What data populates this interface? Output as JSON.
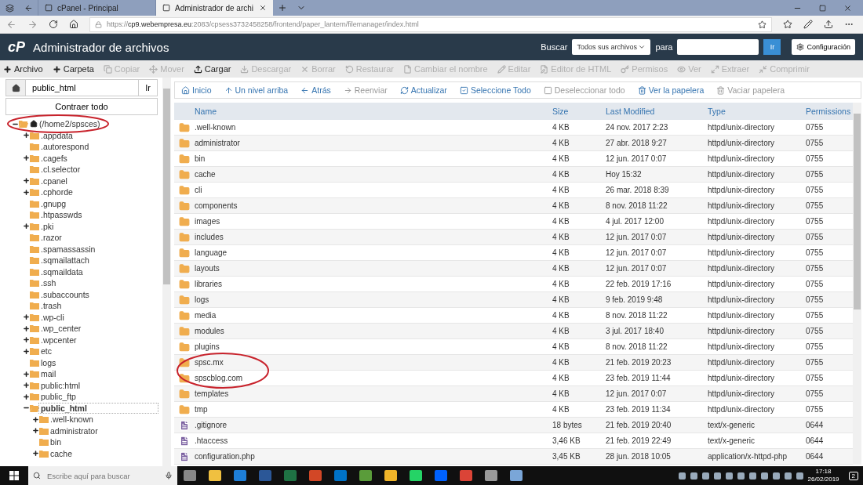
{
  "browser": {
    "tabs": [
      {
        "title": "cPanel - Principal",
        "selected": false
      },
      {
        "title": "Administrador de archi",
        "selected": true
      }
    ],
    "url": "https://**cp9.webempresa.eu**:2083/cpsess3732458258/frontend/paper_lantern/filemanager/index.html"
  },
  "header": {
    "logo": "cP",
    "title": "Administrador de archivos",
    "search_label": "Buscar",
    "scope": "Todos sus archivos",
    "for_label": "para",
    "go": "Ir",
    "settings": "Configuración"
  },
  "toolbar": [
    {
      "label": "Archivo",
      "disabled": false
    },
    {
      "label": "Carpeta",
      "disabled": false
    },
    {
      "label": "Copiar",
      "disabled": true
    },
    {
      "label": "Mover",
      "disabled": true
    },
    {
      "label": "Cargar",
      "disabled": false
    },
    {
      "label": "Descargar",
      "disabled": true
    },
    {
      "label": "Borrar",
      "disabled": true
    },
    {
      "label": "Restaurar",
      "disabled": true
    },
    {
      "label": "Cambiar el nombre",
      "disabled": true
    },
    {
      "label": "Editar",
      "disabled": true
    },
    {
      "label": "Editor de HTML",
      "disabled": true
    },
    {
      "label": "Permisos",
      "disabled": true
    },
    {
      "label": "Ver",
      "disabled": true
    },
    {
      "label": "Extraer",
      "disabled": true
    },
    {
      "label": "Comprimir",
      "disabled": true
    }
  ],
  "sidebar": {
    "path": "public_html",
    "go": "Ir",
    "collapse": "Contraer todo",
    "tree": [
      {
        "label": "(/home2/spsces)",
        "circled": true,
        "expandable": true,
        "expanded": true,
        "selected": false,
        "children": [
          {
            "label": ".appdata",
            "expandable": true,
            "expanded": false,
            "selected": false
          },
          {
            "label": ".autorespond",
            "expandable": false,
            "expanded": false,
            "selected": false
          },
          {
            "label": ".cagefs",
            "expandable": true,
            "expanded": false,
            "selected": false
          },
          {
            "label": ".cl.selector",
            "expandable": false,
            "expanded": false,
            "selected": false
          },
          {
            "label": ".cpanel",
            "expandable": true,
            "expanded": false,
            "selected": false
          },
          {
            "label": ".cphorde",
            "expandable": true,
            "expanded": false,
            "selected": false
          },
          {
            "label": ".gnupg",
            "expandable": false,
            "expanded": false,
            "selected": false
          },
          {
            "label": ".htpasswds",
            "expandable": false,
            "expanded": false,
            "selected": false
          },
          {
            "label": ".pki",
            "expandable": true,
            "expanded": false,
            "selected": false
          },
          {
            "label": ".razor",
            "expandable": false,
            "expanded": false,
            "selected": false
          },
          {
            "label": ".spamassassin",
            "expandable": false,
            "expanded": false,
            "selected": false
          },
          {
            "label": ".sqmailattach",
            "expandable": false,
            "expanded": false,
            "selected": false
          },
          {
            "label": ".sqmaildata",
            "expandable": false,
            "expanded": false,
            "selected": false
          },
          {
            "label": ".ssh",
            "expandable": false,
            "expanded": false,
            "selected": false
          },
          {
            "label": ".subaccounts",
            "expandable": false,
            "expanded": false,
            "selected": false
          },
          {
            "label": ".trash",
            "expandable": false,
            "expanded": false,
            "selected": false
          },
          {
            "label": ".wp-cli",
            "expandable": true,
            "expanded": false,
            "selected": false
          },
          {
            "label": ".wp_center",
            "expandable": true,
            "expanded": false,
            "selected": false
          },
          {
            "label": ".wpcenter",
            "expandable": true,
            "expanded": false,
            "selected": false
          },
          {
            "label": "etc",
            "expandable": true,
            "expanded": false,
            "selected": false
          },
          {
            "label": "logs",
            "expandable": false,
            "expanded": false,
            "selected": false
          },
          {
            "label": "mail",
            "expandable": true,
            "expanded": false,
            "selected": false
          },
          {
            "label": "public:html",
            "expandable": true,
            "expanded": false,
            "selected": false
          },
          {
            "label": "public_ftp",
            "expandable": true,
            "expanded": false,
            "selected": false
          },
          {
            "label": "public_html",
            "expandable": true,
            "expanded": true,
            "selected": true,
            "children": [
              {
                "label": ".well-known",
                "expandable": true,
                "expanded": false,
                "selected": false
              },
              {
                "label": "administrator",
                "expandable": true,
                "expanded": false,
                "selected": false
              },
              {
                "label": "bin",
                "expandable": false,
                "expanded": false,
                "selected": false
              },
              {
                "label": "cache",
                "expandable": true,
                "expanded": false,
                "selected": false
              }
            ]
          }
        ]
      }
    ]
  },
  "nav": [
    {
      "label": "Inicio",
      "disabled": false
    },
    {
      "label": "Un nivel arriba",
      "disabled": false
    },
    {
      "label": "Atrás",
      "disabled": false
    },
    {
      "label": "Reenviar",
      "disabled": true
    },
    {
      "label": "Actualizar",
      "disabled": false
    },
    {
      "label": "Seleccione Todo",
      "disabled": false
    },
    {
      "label": "Deseleccionar todo",
      "disabled": true
    },
    {
      "label": "Ver la papelera",
      "disabled": false
    },
    {
      "label": "Vaciar papelera",
      "disabled": true
    }
  ],
  "table": {
    "columns": [
      "Name",
      "Size",
      "Last Modified",
      "Type",
      "Permissions"
    ],
    "rows": [
      {
        "kind": "folder",
        "name": ".well-known",
        "size": "4 KB",
        "modified": "24 nov. 2017 2:23",
        "type": "httpd/unix-directory",
        "perms": "0755",
        "circled": false
      },
      {
        "kind": "folder",
        "name": "administrator",
        "size": "4 KB",
        "modified": "27 abr. 2018 9:27",
        "type": "httpd/unix-directory",
        "perms": "0755",
        "circled": false
      },
      {
        "kind": "folder",
        "name": "bin",
        "size": "4 KB",
        "modified": "12 jun. 2017 0:07",
        "type": "httpd/unix-directory",
        "perms": "0755",
        "circled": false
      },
      {
        "kind": "folder",
        "name": "cache",
        "size": "4 KB",
        "modified": "Hoy 15:32",
        "type": "httpd/unix-directory",
        "perms": "0755",
        "circled": false
      },
      {
        "kind": "folder",
        "name": "cli",
        "size": "4 KB",
        "modified": "26 mar. 2018 8:39",
        "type": "httpd/unix-directory",
        "perms": "0755",
        "circled": false
      },
      {
        "kind": "folder",
        "name": "components",
        "size": "4 KB",
        "modified": "8 nov. 2018 11:22",
        "type": "httpd/unix-directory",
        "perms": "0755",
        "circled": false
      },
      {
        "kind": "folder",
        "name": "images",
        "size": "4 KB",
        "modified": "4 jul. 2017 12:00",
        "type": "httpd/unix-directory",
        "perms": "0755",
        "circled": false
      },
      {
        "kind": "folder",
        "name": "includes",
        "size": "4 KB",
        "modified": "12 jun. 2017 0:07",
        "type": "httpd/unix-directory",
        "perms": "0755",
        "circled": false
      },
      {
        "kind": "folder",
        "name": "language",
        "size": "4 KB",
        "modified": "12 jun. 2017 0:07",
        "type": "httpd/unix-directory",
        "perms": "0755",
        "circled": false
      },
      {
        "kind": "folder",
        "name": "layouts",
        "size": "4 KB",
        "modified": "12 jun. 2017 0:07",
        "type": "httpd/unix-directory",
        "perms": "0755",
        "circled": false
      },
      {
        "kind": "folder",
        "name": "libraries",
        "size": "4 KB",
        "modified": "22 feb. 2019 17:16",
        "type": "httpd/unix-directory",
        "perms": "0755",
        "circled": false
      },
      {
        "kind": "folder",
        "name": "logs",
        "size": "4 KB",
        "modified": "9 feb. 2019 9:48",
        "type": "httpd/unix-directory",
        "perms": "0755",
        "circled": false
      },
      {
        "kind": "folder",
        "name": "media",
        "size": "4 KB",
        "modified": "8 nov. 2018 11:22",
        "type": "httpd/unix-directory",
        "perms": "0755",
        "circled": false
      },
      {
        "kind": "folder",
        "name": "modules",
        "size": "4 KB",
        "modified": "3 jul. 2017 18:40",
        "type": "httpd/unix-directory",
        "perms": "0755",
        "circled": false
      },
      {
        "kind": "folder",
        "name": "plugins",
        "size": "4 KB",
        "modified": "8 nov. 2018 11:22",
        "type": "httpd/unix-directory",
        "perms": "0755",
        "circled": false
      },
      {
        "kind": "folder",
        "name": "spsc.mx",
        "size": "4 KB",
        "modified": "21 feb. 2019 20:23",
        "type": "httpd/unix-directory",
        "perms": "0755",
        "circled": true
      },
      {
        "kind": "folder",
        "name": "spscblog.com",
        "size": "4 KB",
        "modified": "23 feb. 2019 11:44",
        "type": "httpd/unix-directory",
        "perms": "0755",
        "circled": true
      },
      {
        "kind": "folder",
        "name": "templates",
        "size": "4 KB",
        "modified": "12 jun. 2017 0:07",
        "type": "httpd/unix-directory",
        "perms": "0755",
        "circled": false
      },
      {
        "kind": "folder",
        "name": "tmp",
        "size": "4 KB",
        "modified": "23 feb. 2019 11:34",
        "type": "httpd/unix-directory",
        "perms": "0755",
        "circled": false
      },
      {
        "kind": "file",
        "name": ".gitignore",
        "size": "18 bytes",
        "modified": "21 feb. 2019 20:40",
        "type": "text/x-generic",
        "perms": "0644",
        "circled": false
      },
      {
        "kind": "file",
        "name": ".htaccess",
        "size": "3,46 KB",
        "modified": "21 feb. 2019 22:49",
        "type": "text/x-generic",
        "perms": "0644",
        "circled": false
      },
      {
        "kind": "file",
        "name": "configuration.php",
        "size": "3,45 KB",
        "modified": "28 jun. 2018 10:05",
        "type": "application/x-httpd-php",
        "perms": "0644",
        "circled": false
      }
    ]
  },
  "taskbar": {
    "search_placeholder": "Escribe aquí para buscar",
    "time": "17:18",
    "date": "26/02/2019",
    "notifications": "2"
  }
}
